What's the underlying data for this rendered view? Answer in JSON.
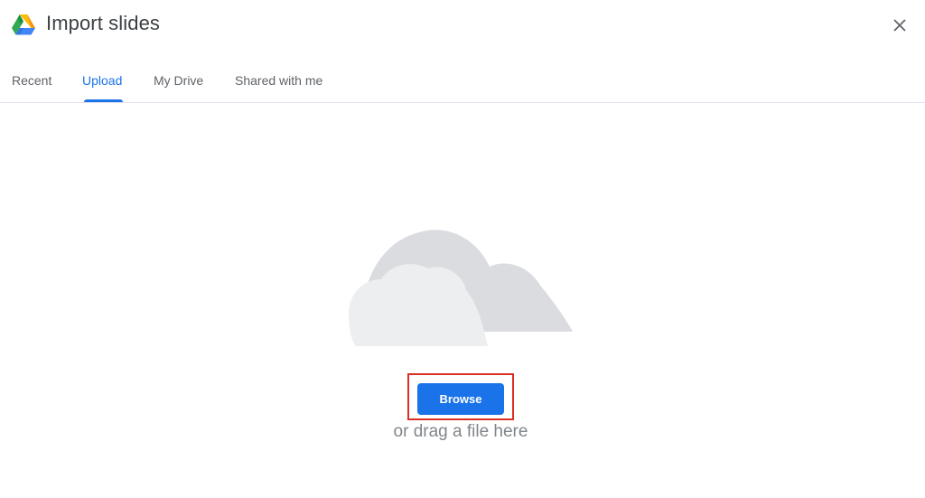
{
  "dialog": {
    "title": "Import slides",
    "logo_icon": "google-drive-logo",
    "close_icon": "close-icon"
  },
  "tabs": [
    {
      "label": "Recent",
      "active": false
    },
    {
      "label": "Upload",
      "active": true
    },
    {
      "label": "My Drive",
      "active": false
    },
    {
      "label": "Shared with me",
      "active": false
    }
  ],
  "upload": {
    "illustration_icon": "cloud-icon",
    "browse_label": "Browse",
    "drag_hint": "or drag a file here"
  },
  "colors": {
    "accent": "#1a73e8",
    "highlight_border": "#d93025",
    "text_primary": "#3c4043",
    "text_secondary": "#5f6368",
    "hint_text": "#80868b",
    "cloud_back": "#dadce0",
    "cloud_front": "#eceef0"
  }
}
